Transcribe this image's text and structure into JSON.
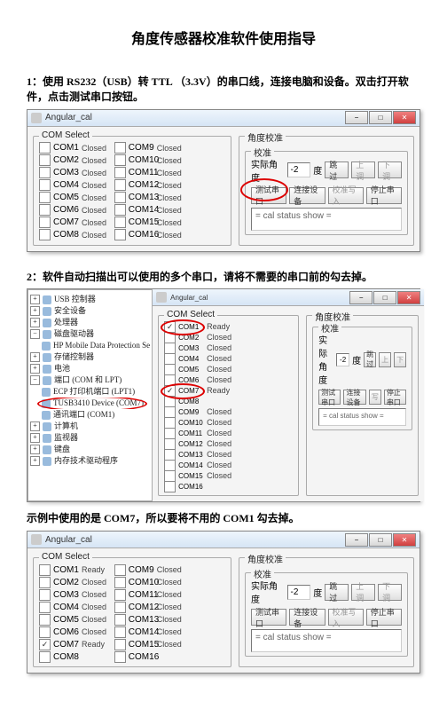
{
  "doc": {
    "title": "角度传感器校准软件使用指导",
    "step1": "1：使用 RS232（USB）转 TTL （3.3V）的串口线，连接电脑和设备。双击打开软件，点击测试串口按钮。",
    "step2": "2：软件自动扫描出可以使用的多个串口，请将不需要的串口前的勾去掉。",
    "step3": "示例中使用的是 COM7，所以要将不用的 COM1 勾去掉。"
  },
  "app": {
    "title": "Angular_cal"
  },
  "groups": {
    "com_select": "COM Select",
    "angle_cal": "角度校准",
    "cal": "校准"
  },
  "status": {
    "closed": "Closed",
    "ready": "Ready"
  },
  "com": {
    "c1": "COM1",
    "c2": "COM2",
    "c3": "COM3",
    "c4": "COM4",
    "c5": "COM5",
    "c6": "COM6",
    "c7": "COM7",
    "c8": "COM8",
    "c9": "COM9",
    "c10": "COM10",
    "c11": "COM11",
    "c12": "COM12",
    "c13": "COM13",
    "c14": "COM14",
    "c15": "COM15",
    "c16": "COM16"
  },
  "cal": {
    "actual_angle": "实际角度",
    "angle_value": "-2",
    "degree": "度",
    "skip": "跳过",
    "up": "上调",
    "down": "下调",
    "test_port": "测试串口",
    "connect": "连接设备",
    "write": "校准写入",
    "stop": "停止串口",
    "status_show": "= cal status show ="
  },
  "tree": {
    "t0": "USB 控制器",
    "t1": "安全设备",
    "t2": "处理器",
    "t3": "磁盘驱动器",
    "t4": "HP Mobile Data Protection Se",
    "t5": "存储控制器",
    "t6": "电池",
    "t7": "端口 (COM 和 LPT)",
    "t8": "ECP 打印机端口 (LPT1)",
    "t9": "TUSB3410 Device (COM7)",
    "t10": "通讯端口 (COM1)",
    "t11": "计算机",
    "t12": "监视器",
    "t13": "键盘",
    "t14": "内存技术驱动程序"
  },
  "winctl": {
    "min": "−",
    "max": "□",
    "close": "✕"
  }
}
